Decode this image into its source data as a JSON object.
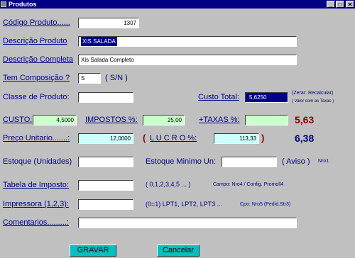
{
  "window": {
    "title": "Produtos",
    "minimize": "_",
    "maximize": "□",
    "close": "✕"
  },
  "form": {
    "codigo": {
      "label": "Código Produto......",
      "value": "1307"
    },
    "descricao": {
      "label": "Descrição Produto",
      "value": "XIS SALADA"
    },
    "descricao_completa": {
      "label": "Descrição Completa",
      "value": "Xis Salada Completo"
    },
    "composicao": {
      "label": "Tem Composição ?",
      "value": "S",
      "hint": "( S/N )"
    },
    "classe": {
      "label": "Classe de Produto:",
      "value": ""
    },
    "custo_total": {
      "label": "Custo Total:",
      "value": "5,6250",
      "hint1": "(Zerar: Recalcular)",
      "hint2": "( Valor com as Taxas )"
    },
    "custo": {
      "label": "CUSTO:",
      "value": "4,5000"
    },
    "impostos": {
      "label": "IMPOSTOS %:",
      "value": "25,00"
    },
    "taxas": {
      "label": "+TAXAS %:",
      "value": "",
      "result": "5,63"
    },
    "preco": {
      "label": "Preço Unitario.......:",
      "value": "12,0000"
    },
    "lucro": {
      "open": "(",
      "label": "L U C R O  %:",
      "value": "113,33",
      "close": ")",
      "result": "6,38"
    },
    "estoque": {
      "label": "Estoque (Unidades)",
      "value": ""
    },
    "estoque_min": {
      "label": "Estoque Minimo Un:",
      "value": "",
      "aviso": "( Aviso )",
      "hint": "Nro1"
    },
    "tabela_imposto": {
      "label": "Tabela de Imposto:",
      "value": "",
      "options": "( 0,1,2,3,4,5 ... )",
      "hint": "Campo: Nro4 / Config. Promoll4"
    },
    "impressora": {
      "label": "Impressora (1,2,3):",
      "value": "",
      "options": "(0=1) LPT1,  LPT2,  LPT3 ...",
      "hint": "Cpo: Nro5 (Pedid.Str3)"
    },
    "comentarios": {
      "label": "Comentarios.........:",
      "value": ""
    }
  },
  "buttons": {
    "save": "GRAVAR",
    "cancel": "Cancelar"
  },
  "colors": {
    "title_bar": "#000084",
    "label": "#00008b",
    "taxas_result": "#8b0000",
    "lucro_result": "#00008b",
    "button": "#00c0c0",
    "field_green": "#ccffcc",
    "field_cyan": "#ccffff"
  }
}
